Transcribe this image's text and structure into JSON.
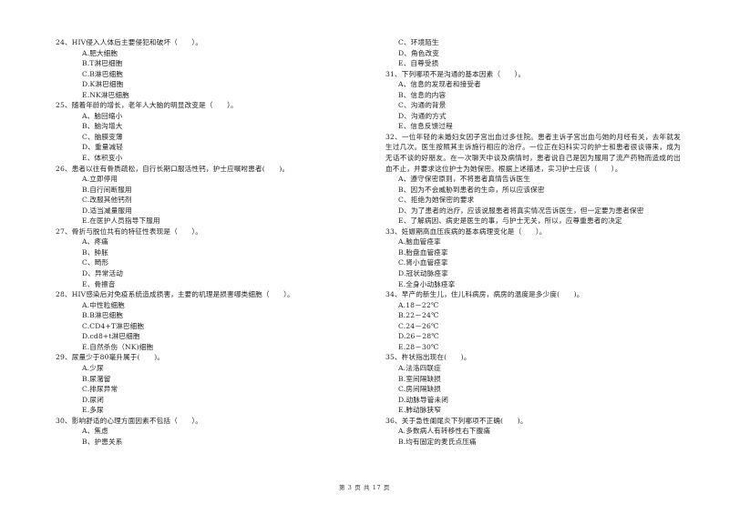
{
  "left_column": [
    {
      "type": "question",
      "text": "24、HIV侵入人体后主要侵犯和破坏（　　）。"
    },
    {
      "type": "option",
      "text": "A.肥大细胞"
    },
    {
      "type": "option",
      "text": "B.T淋巴细胞"
    },
    {
      "type": "option",
      "text": "C.B淋巴细胞"
    },
    {
      "type": "option",
      "text": "D.K淋巴细胞"
    },
    {
      "type": "option",
      "text": "E.NK淋巴细胞"
    },
    {
      "type": "question",
      "text": "25、随着年龄的增长，老年人大脑的明显改变是（　　）。"
    },
    {
      "type": "option",
      "text": "A、脑回缩小"
    },
    {
      "type": "option",
      "text": "B、脑沟增大"
    },
    {
      "type": "option",
      "text": "C、脑膜变薄"
    },
    {
      "type": "option",
      "text": "D、重量减轻"
    },
    {
      "type": "option",
      "text": "E、体积变小"
    },
    {
      "type": "question",
      "text": "26、患者以往有骨质疏松，自行长期口服活性钙，护士应嘱咐患者(　　)。"
    },
    {
      "type": "option",
      "text": "A.立即停用"
    },
    {
      "type": "option",
      "text": "B.自行间断服用"
    },
    {
      "type": "option",
      "text": "C.改服其他钙剂"
    },
    {
      "type": "option",
      "text": "D.适当减量服用"
    },
    {
      "type": "option",
      "text": "E.在医护人员指导下服用"
    },
    {
      "type": "question",
      "text": "27、骨折与脱位共有的特征性表现是（　　）。"
    },
    {
      "type": "option",
      "text": "A、疼痛"
    },
    {
      "type": "option",
      "text": "B、肿胀"
    },
    {
      "type": "option",
      "text": "C、畸形"
    },
    {
      "type": "option",
      "text": "D、异常活动"
    },
    {
      "type": "option",
      "text": "E、骨擦音"
    },
    {
      "type": "question",
      "text": "28、HIV感染后对免疫系统造成损害，主要的机理是损害哪类细胞（　　）。"
    },
    {
      "type": "option",
      "text": "A.中性粒细胞"
    },
    {
      "type": "option",
      "text": "B.B淋巴细胞"
    },
    {
      "type": "option",
      "text": "C.CD4+T淋巴细胞"
    },
    {
      "type": "option",
      "text": "D.cd8+t淋巴细胞"
    },
    {
      "type": "option",
      "text": "E.自然杀伤（NK)细胞"
    },
    {
      "type": "question",
      "text": "29、尿量少于80毫升属于(　　)。"
    },
    {
      "type": "option",
      "text": "A.少尿"
    },
    {
      "type": "option",
      "text": "B.尿潴留"
    },
    {
      "type": "option",
      "text": "C.排尿异常"
    },
    {
      "type": "option",
      "text": "D.尿闭"
    },
    {
      "type": "option",
      "text": "E.多尿"
    },
    {
      "type": "question",
      "text": "30、影响舒适的心理方面因素不包括（　　）。"
    },
    {
      "type": "option",
      "text": "A、焦虑"
    },
    {
      "type": "option",
      "text": "B、护患关系"
    }
  ],
  "right_column": [
    {
      "type": "option",
      "text": "C、环境陌生"
    },
    {
      "type": "option",
      "text": "D、角色改变"
    },
    {
      "type": "option",
      "text": "E、自尊受损"
    },
    {
      "type": "question",
      "text": "31、下列哪项不是沟通的基本因素（　　）。"
    },
    {
      "type": "option",
      "text": "A、信息的发现者和接受者"
    },
    {
      "type": "option",
      "text": "B、信息的内容"
    },
    {
      "type": "option",
      "text": "C、沟通的背景"
    },
    {
      "type": "option",
      "text": "D、沟通的方式"
    },
    {
      "type": "option",
      "text": "E、信息反馈过程"
    },
    {
      "type": "paragraph",
      "text": "32、一位年轻的未婚妇女因子宫出血过多住院。患者主诉子宫出血与她的月经有关，去年就发生过几次。医生按照其主诉施行相应的治疗。一位正在妇科实习的护士和患者很谈得来，成为无话不谈的好朋友。在一次聊天中谈及病情时，患者说自己是因为服用了流产药物而造成的出血不止，并要求这位护士为她保密。根据上述描述，实习护士应该（　　）。"
    },
    {
      "type": "option",
      "text": "A、遵守保密原则，不将患者真情告诉医生"
    },
    {
      "type": "option",
      "text": "B、因为不会威胁到患者的生命，所以应该保密"
    },
    {
      "type": "option",
      "text": "C、拒绝为她保密的要求"
    },
    {
      "type": "option",
      "text": "D、为了患者的治疗，应该说服患者将真实情况告诉医生，但一定要为患者保密"
    },
    {
      "type": "option",
      "text": "E、了解病因、病史是医生的事，与护士无关，所以，应尊重患者的决定"
    },
    {
      "type": "question",
      "text": "33、妊娠期高血压疾病的基本病理变化是（　　）。"
    },
    {
      "type": "option",
      "text": "A.脑血管痉挛"
    },
    {
      "type": "option",
      "text": "B.胎盘血管痉挛"
    },
    {
      "type": "option",
      "text": "C.肾小血管痉挛"
    },
    {
      "type": "option",
      "text": "D.冠状动脉痉挛"
    },
    {
      "type": "option",
      "text": "E.全身小动脉痉挛"
    },
    {
      "type": "question",
      "text": "34、早产的新生儿，住儿科病房，病房的温度是多少度(　　)。"
    },
    {
      "type": "option",
      "text": "A.18－22℃"
    },
    {
      "type": "option",
      "text": "B.22－24℃"
    },
    {
      "type": "option",
      "text": "C.24－26℃"
    },
    {
      "type": "option",
      "text": "D.26－28℃"
    },
    {
      "type": "option",
      "text": "E.28－30℃"
    },
    {
      "type": "question",
      "text": "35、杵状指出现在(　　)。"
    },
    {
      "type": "option",
      "text": "A.法洛四联症"
    },
    {
      "type": "option",
      "text": "B.室间隔缺损"
    },
    {
      "type": "option",
      "text": "C.房间隔缺损"
    },
    {
      "type": "option",
      "text": "D.动脉导管未闭"
    },
    {
      "type": "option",
      "text": "E.肺动脉狭窄"
    },
    {
      "type": "question",
      "text": "36、关于急性阑尾炎下列哪项不正确(　　)。"
    },
    {
      "type": "option",
      "text": "A.多数病人有转移性右下腹痛"
    },
    {
      "type": "option",
      "text": "B.均有固定的麦氏点压痛"
    }
  ],
  "footer": {
    "page_label": "第 3 页 共 17 页"
  }
}
